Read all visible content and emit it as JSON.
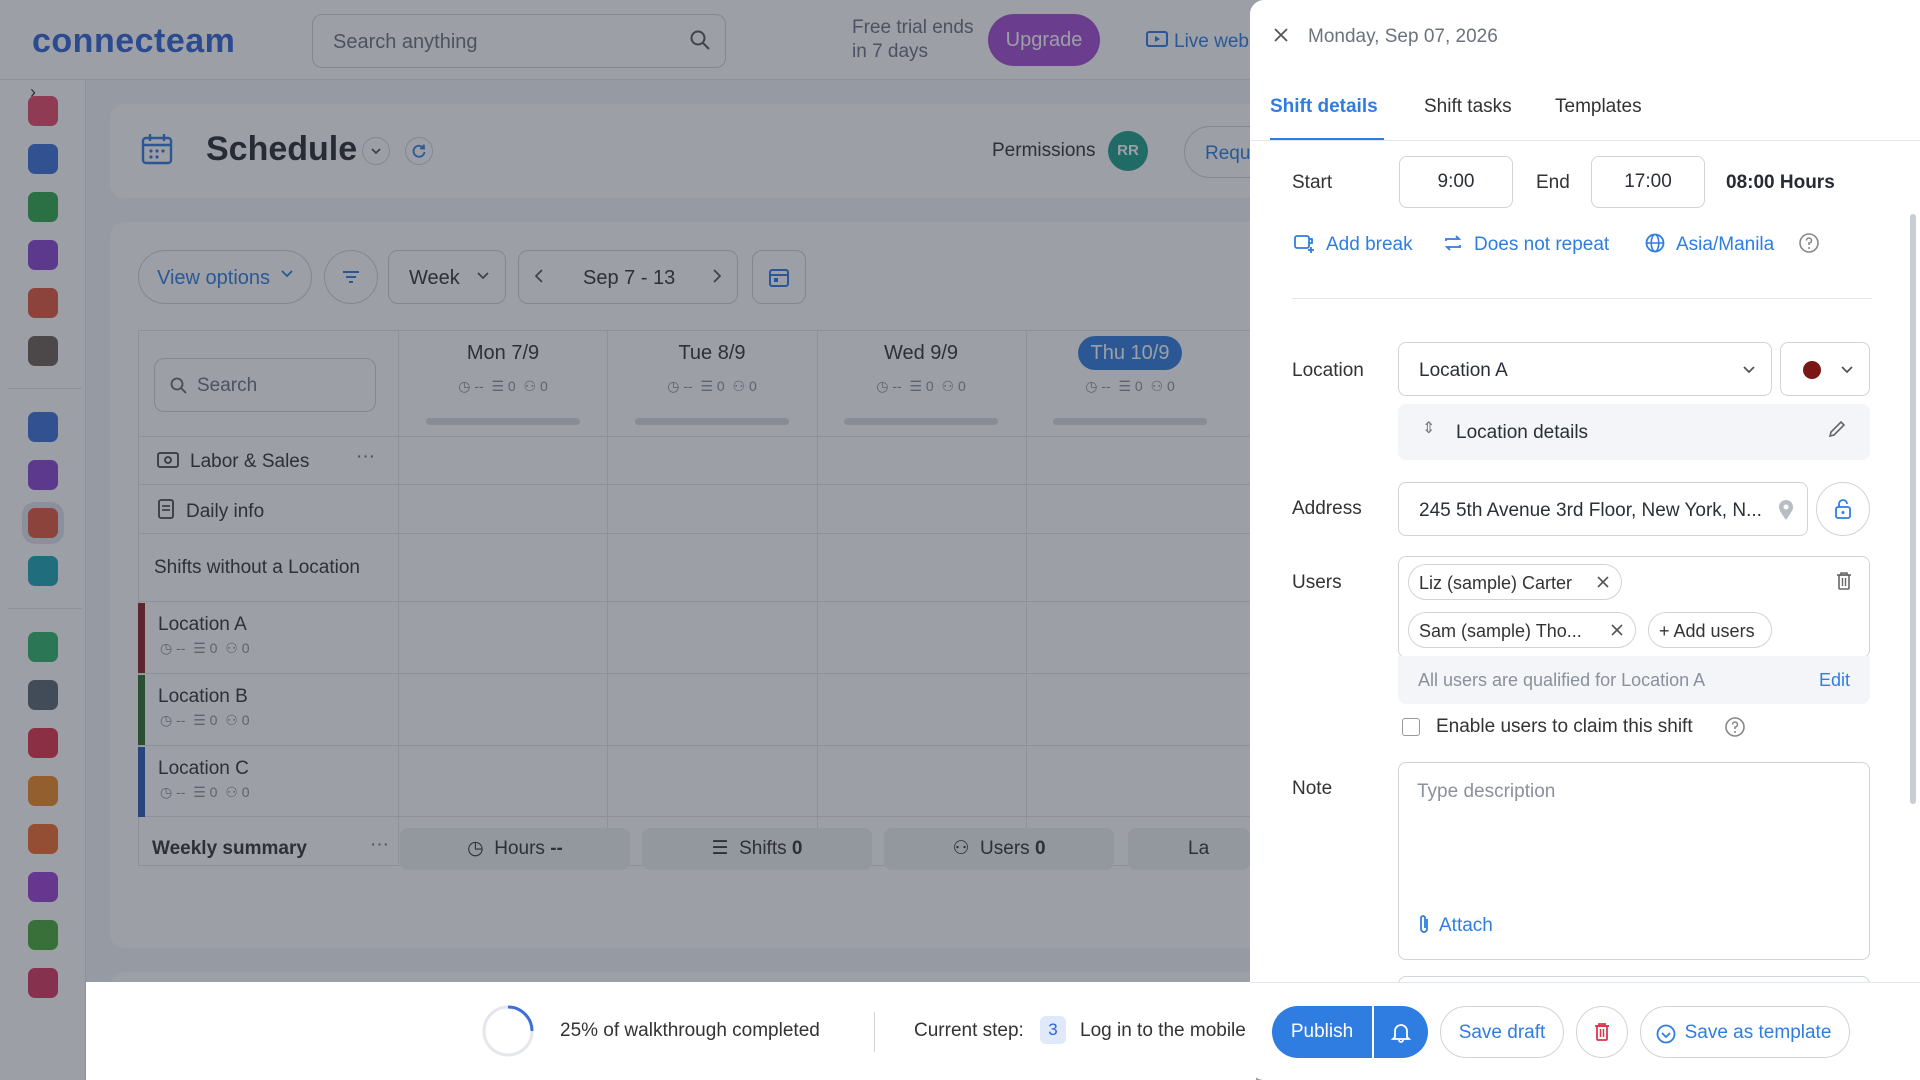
{
  "topbar": {
    "logo": "connecteam",
    "search_placeholder": "Search anything",
    "trial_line1": "Free trial ends",
    "trial_line2": "in 7 days",
    "upgrade_label": "Upgrade",
    "live_label": "Live web"
  },
  "schedule": {
    "title": "Schedule",
    "permissions_label": "Permissions",
    "avatar_initials": "RR",
    "request_label": "Requ",
    "view_options_label": "View options",
    "period_label": "Week",
    "range_label": "Sep 7 - 13",
    "grid_search_placeholder": "Search",
    "days": [
      {
        "label": "Mon 7/9",
        "hours": "--",
        "shifts": "0",
        "users": "0"
      },
      {
        "label": "Tue 8/9",
        "hours": "--",
        "shifts": "0",
        "users": "0"
      },
      {
        "label": "Wed 9/9",
        "hours": "--",
        "shifts": "0",
        "users": "0"
      },
      {
        "label": "Thu 10/9",
        "hours": "--",
        "shifts": "0",
        "users": "0",
        "today": true
      }
    ],
    "rows": {
      "labor_sales": "Labor & Sales",
      "daily_info": "Daily info",
      "no_location": "Shifts without a Location"
    },
    "locations": [
      {
        "name": "Location A",
        "hours": "--",
        "shifts": "0",
        "users": "0",
        "color": "#8b1f24"
      },
      {
        "name": "Location B",
        "hours": "--",
        "shifts": "0",
        "users": "0",
        "color": "#2e6b2e"
      },
      {
        "name": "Location C",
        "hours": "--",
        "shifts": "0",
        "users": "0",
        "color": "#2a58b5"
      }
    ],
    "weekly_summary": {
      "label": "Weekly summary",
      "hours_label": "Hours",
      "hours_value": "--",
      "shifts_label": "Shifts",
      "shifts_value": "0",
      "users_label": "Users",
      "users_value": "0",
      "labor_label": "La"
    }
  },
  "walkthrough": {
    "progress_fraction": 0.25,
    "progress_text": "25% of walkthrough completed",
    "current_step_label": "Current step:",
    "step_number": "3",
    "step_text": "Log in to the mobile"
  },
  "panel": {
    "date": "Monday, Sep 07, 2026",
    "tabs": [
      "Shift details",
      "Shift tasks",
      "Templates"
    ],
    "start_label": "Start",
    "start_value": "9:00",
    "end_label": "End",
    "end_value": "17:00",
    "duration": "08:00 Hours",
    "add_break": "Add break",
    "repeat": "Does not repeat",
    "timezone": "Asia/Manila",
    "location_label": "Location",
    "location_value": "Location A",
    "location_color": "#7a1616",
    "location_details": "Location details",
    "address_label": "Address",
    "address_value": "245 5th Avenue 3rd Floor, New York, N...",
    "users_label": "Users",
    "users": [
      "Liz (sample) Carter",
      "Sam (sample) Tho..."
    ],
    "add_users": "+ Add users",
    "qualified_text": "All users are qualified for Location A",
    "edit_label": "Edit",
    "claim_label": "Enable users to claim this shift",
    "note_label": "Note",
    "note_placeholder": "Type description",
    "attach_label": "Attach",
    "publish_label": "Publish",
    "save_draft_label": "Save draft",
    "save_template_label": "Save as template"
  }
}
